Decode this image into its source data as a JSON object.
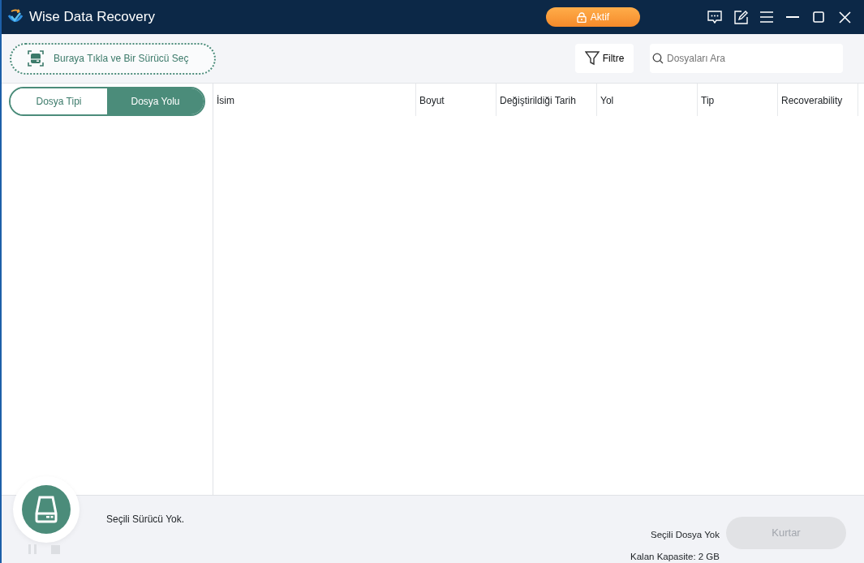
{
  "window": {
    "title": "Wise Data Recovery"
  },
  "license_button": {
    "label": "Aktif"
  },
  "drive_picker": {
    "label": "Buraya Tıkla ve Bir Sürücü Seç"
  },
  "filter_button": {
    "label": "Filtre"
  },
  "search": {
    "placeholder": "Dosyaları Ara"
  },
  "tabs": [
    {
      "label": "Dosya Tipi",
      "selected": false
    },
    {
      "label": "Dosya Yolu",
      "selected": true
    }
  ],
  "table": {
    "columns": [
      "İsim",
      "Boyut",
      "Değiştirildiği Tarih",
      "Yol",
      "Tip",
      "Recoverability"
    ]
  },
  "status": {
    "drive": "Seçili Sürücü Yok.",
    "selected_files": "Seçili Dosya Yok",
    "capacity": "Kalan Kapasite: 2 GB"
  },
  "controls": {
    "pause_disabled": true,
    "stop_disabled": true
  },
  "recover_button": {
    "label": "Kurtar",
    "disabled": true
  }
}
